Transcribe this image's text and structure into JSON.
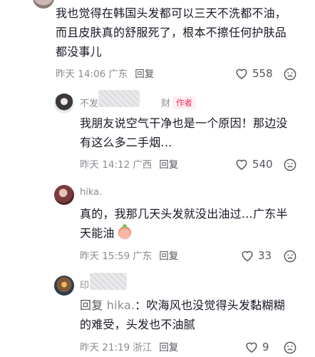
{
  "comments": [
    {
      "text_lines": [
        "我也觉得在韩国头发都可以三天不洗都不油，",
        "而且皮肤真的舒服死了，根本不擦任何护肤品",
        "都没事儿"
      ],
      "time": "昨天 14:06",
      "location": "广东",
      "reply_label": "回复",
      "likes": "558"
    },
    {
      "author_visible": "不发",
      "author_tail": "财",
      "author_badge": "作者",
      "text_lines": [
        "我朋友说空气干净也是一个原因！那边没",
        "有这么多二手烟…"
      ],
      "time": "昨天 14:12",
      "location": "广西",
      "reply_label": "回复",
      "likes": "540"
    },
    {
      "author_visible": "hika.",
      "text_lines": [
        "真的，我那几天头发就没出油过…广东半",
        "天能油"
      ],
      "time": "昨天 15:59",
      "location": "广东",
      "reply_label": "回复",
      "likes": "33"
    },
    {
      "author_visible": "印",
      "reply_prefix": "回复",
      "reply_to": "hika.",
      "text_first": "：吹海风也没觉得头发黏糊糊",
      "text_second": "的难受，头发也不油腻",
      "time": "昨天 21:19",
      "location": "浙江",
      "reply_label": "回复",
      "likes": "9"
    }
  ],
  "icons": {
    "like": "heart-outline-icon",
    "dislike": "dislike-face-icon"
  }
}
